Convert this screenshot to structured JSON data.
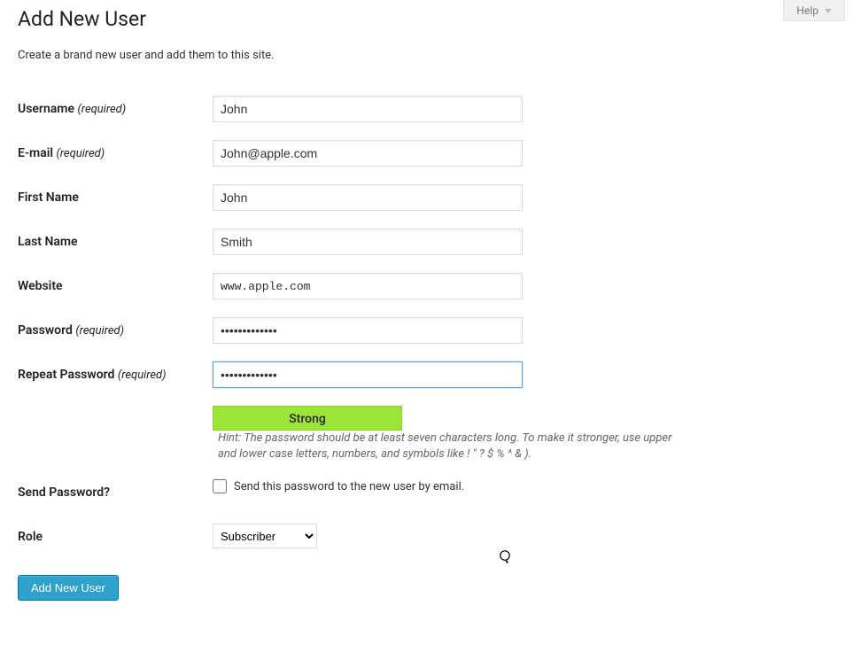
{
  "help": {
    "label": "Help"
  },
  "page": {
    "title": "Add New User",
    "intro": "Create a brand new user and add them to this site."
  },
  "fields": {
    "username": {
      "label": "Username ",
      "req": "(required)",
      "value": "John"
    },
    "email": {
      "label": "E-mail ",
      "req": "(required)",
      "value": "John@apple.com"
    },
    "first_name": {
      "label": "First Name",
      "value": "John"
    },
    "last_name": {
      "label": "Last Name",
      "value": "Smith"
    },
    "website": {
      "label": "Website",
      "value": "www.apple.com"
    },
    "password": {
      "label": "Password ",
      "req": "(required)",
      "value": "•••••••••••••"
    },
    "repeat_password": {
      "label": "Repeat Password ",
      "req": "(required)",
      "value": "•••••••••••••"
    },
    "strength": {
      "label": "Strong"
    },
    "hint": "Hint: The password should be at least seven characters long. To make it stronger, use upper and lower case letters, numbers, and symbols like ! \" ? $ % ^ & ).",
    "send_password": {
      "label": "Send Password?",
      "checkbox_label": "Send this password to the new user by email."
    },
    "role": {
      "label": "Role",
      "selected": "Subscriber"
    }
  },
  "submit": {
    "label": "Add New User"
  }
}
